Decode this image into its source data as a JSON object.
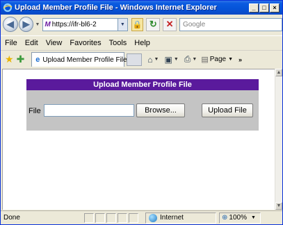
{
  "window": {
    "title": "Upload Member Profile File - Windows Internet Explorer",
    "min_glyph": "_",
    "max_glyph": "□",
    "close_glyph": "×"
  },
  "address_bar": {
    "url": "https://ifr-bl6-2",
    "search_placeholder": "Google"
  },
  "menu": {
    "items": [
      "File",
      "Edit",
      "View",
      "Favorites",
      "Tools",
      "Help"
    ]
  },
  "tabs": {
    "active_label": "Upload Member Profile File"
  },
  "command_bar": {
    "page_label": "Page",
    "overflow": "»"
  },
  "page": {
    "header": "Upload Member Profile File",
    "file_label": "File",
    "file_value": "",
    "browse_label": "Browse...",
    "upload_label": "Upload File"
  },
  "status_bar": {
    "status": "Done",
    "zone": "Internet",
    "zoom": "100%"
  },
  "colors": {
    "panel_header": "#5a1a9c",
    "panel_body": "#c4c4c4",
    "titlebar": "#0553d8"
  }
}
